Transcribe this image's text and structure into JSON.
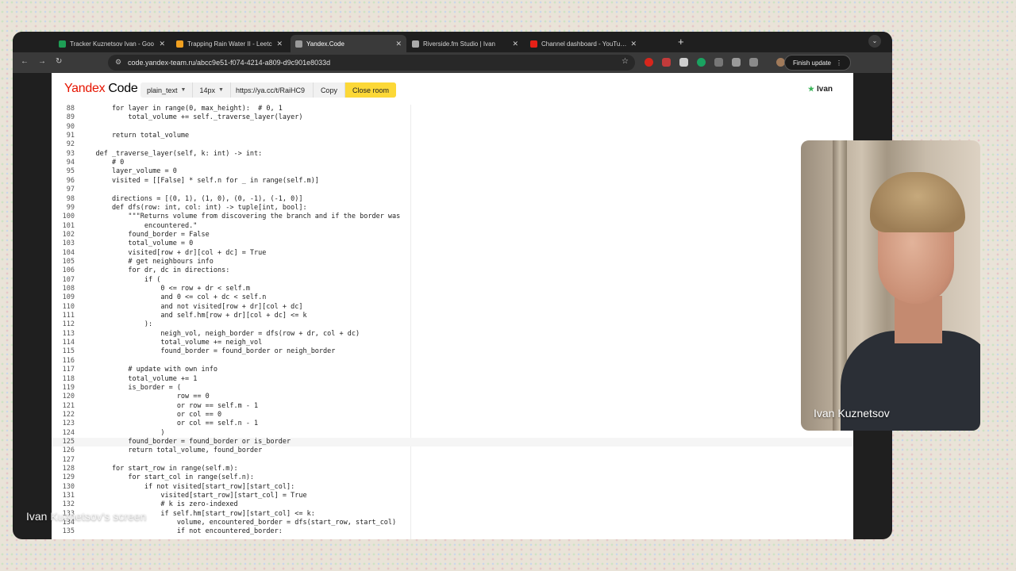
{
  "browser": {
    "tabs": [
      {
        "title": "Tracker Kuznetsov Ivan - Goo",
        "favicon_color": "#1e9e55",
        "active": false
      },
      {
        "title": "Trapping Rain Water II - Leetc",
        "favicon_color": "#f0a020",
        "active": false
      },
      {
        "title": "Yandex.Code",
        "favicon_color": "#9a9a9a",
        "active": true
      },
      {
        "title": "Riverside.fm Studio | Ivan",
        "favicon_color": "#aaaaaa",
        "active": false
      },
      {
        "title": "Channel dashboard - YouTube",
        "favicon_color": "#e62117",
        "active": false
      }
    ],
    "new_tab": "+",
    "tab_close": "✕",
    "url": "code.yandex-team.ru/abcc9e51-f074-4214-a809-d9c901e8033d",
    "finish_update": "Finish update"
  },
  "app": {
    "logo_yandex": "Yandex",
    "logo_code": " Code",
    "language": "plain_text",
    "font_size": "14px",
    "share_url": "https://ya.cc/t/RaiHC9",
    "copy": "Copy",
    "close_room": "Close room",
    "user": "Ivan",
    "accent": "#fcd837"
  },
  "code_lines": [
    {
      "n": "88",
      "t": "        for layer in range(0, max_height):  # 0, 1"
    },
    {
      "n": "89",
      "t": "            total_volume += self._traverse_layer(layer)"
    },
    {
      "n": "90",
      "t": ""
    },
    {
      "n": "91",
      "t": "        return total_volume"
    },
    {
      "n": "92",
      "t": ""
    },
    {
      "n": "93",
      "t": "    def _traverse_layer(self, k: int) -> int:"
    },
    {
      "n": "94",
      "t": "        # 0"
    },
    {
      "n": "95",
      "t": "        layer_volume = 0"
    },
    {
      "n": "96",
      "t": "        visited = [[False] * self.n for _ in range(self.m)]"
    },
    {
      "n": "97",
      "t": ""
    },
    {
      "n": "98",
      "t": "        directions = [(0, 1), (1, 0), (0, -1), (-1, 0)]"
    },
    {
      "n": "99",
      "t": "        def dfs(row: int, col: int) -> tuple[int, bool]:"
    },
    {
      "n": "100",
      "t": "            \"\"\"Returns volume from discovering the branch and if the border was"
    },
    {
      "n": "101",
      "t": "                encountered.\""
    },
    {
      "n": "102",
      "t": "            found_border = False"
    },
    {
      "n": "103",
      "t": "            total_volume = 0"
    },
    {
      "n": "104",
      "t": "            visited[row + dr][col + dc] = True"
    },
    {
      "n": "105",
      "t": "            # get neighbours info"
    },
    {
      "n": "106",
      "t": "            for dr, dc in directions:"
    },
    {
      "n": "107",
      "t": "                if ("
    },
    {
      "n": "108",
      "t": "                    0 <= row + dr < self.m"
    },
    {
      "n": "109",
      "t": "                    and 0 <= col + dc < self.n"
    },
    {
      "n": "110",
      "t": "                    and not visited[row + dr][col + dc]"
    },
    {
      "n": "111",
      "t": "                    and self.hm[row + dr][col + dc] <= k"
    },
    {
      "n": "112",
      "t": "                ):"
    },
    {
      "n": "113",
      "t": "                    neigh_vol, neigh_border = dfs(row + dr, col + dc)"
    },
    {
      "n": "114",
      "t": "                    total_volume += neigh_vol"
    },
    {
      "n": "115",
      "t": "                    found_border = found_border or neigh_border"
    },
    {
      "n": "116",
      "t": ""
    },
    {
      "n": "117",
      "t": "            # update with own info"
    },
    {
      "n": "118",
      "t": "            total_volume += 1"
    },
    {
      "n": "119",
      "t": "            is_border = ("
    },
    {
      "n": "120",
      "t": "                        row == 0"
    },
    {
      "n": "121",
      "t": "                        or row == self.m - 1"
    },
    {
      "n": "122",
      "t": "                        or col == 0"
    },
    {
      "n": "123",
      "t": "                        or col == self.n - 1"
    },
    {
      "n": "124",
      "t": "                    )"
    },
    {
      "n": "125",
      "t": "            found_border = found_border or is_border"
    },
    {
      "n": "126",
      "t": "            return total_volume, found_border"
    },
    {
      "n": "127",
      "t": ""
    },
    {
      "n": "128",
      "t": "        for start_row in range(self.m):"
    },
    {
      "n": "129",
      "t": "            for start_col in range(self.n):"
    },
    {
      "n": "130",
      "t": "                if not visited[start_row][start_col]:"
    },
    {
      "n": "131",
      "t": "                    visited[start_row][start_col] = True"
    },
    {
      "n": "132",
      "t": "                    # k is zero-indexed"
    },
    {
      "n": "133",
      "t": "                    if self.hm[start_row][start_col] <= k:"
    },
    {
      "n": "134",
      "t": "                        volume, encountered_border = dfs(start_row, start_col)"
    },
    {
      "n": "135",
      "t": "                        if not encountered_border:"
    }
  ],
  "current_line": "125",
  "webcam": {
    "name": "Ivan Kuznetsov"
  },
  "screen_share_label": "Ivan Kuznetsov's screen"
}
